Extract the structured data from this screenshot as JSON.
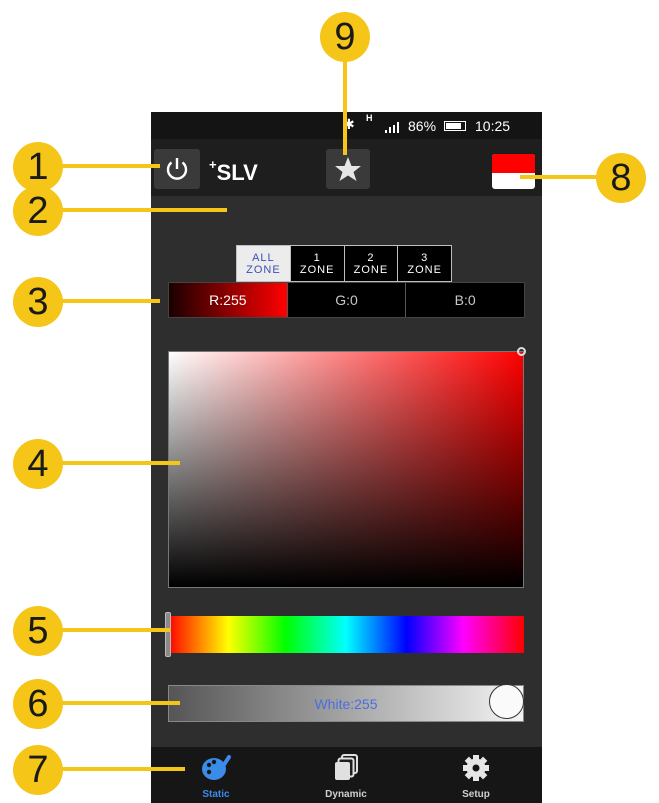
{
  "status_bar": {
    "bluetooth_icon": "bluetooth-icon",
    "network": "H",
    "battery_pct": "86%",
    "battery_level": 0.86,
    "time": "10:25"
  },
  "header": {
    "power_icon": "power-icon",
    "logo_plus": "+",
    "logo_text": "SLV",
    "favorite_icon": "star-icon",
    "current_color": "#ff0000"
  },
  "zones": [
    {
      "top": "ALL",
      "bottom": "ZONE",
      "active": true
    },
    {
      "top": "1",
      "bottom": "ZONE",
      "active": false
    },
    {
      "top": "2",
      "bottom": "ZONE",
      "active": false
    },
    {
      "top": "3",
      "bottom": "ZONE",
      "active": false
    }
  ],
  "rgb": {
    "r": "R:255",
    "g": "G:0",
    "b": "B:0"
  },
  "hue_slider_value": 0,
  "white": {
    "label": "White:255",
    "level": 1.0
  },
  "tabs": [
    {
      "label": "Static",
      "icon": "palette-icon",
      "active": true
    },
    {
      "label": "Dynamic",
      "icon": "layers-icon",
      "active": false
    },
    {
      "label": "Setup",
      "icon": "gear-icon",
      "active": false
    }
  ],
  "callouts": [
    "1",
    "2",
    "3",
    "4",
    "5",
    "6",
    "7",
    "8",
    "9"
  ],
  "colors": {
    "accent": "#3b8ce8",
    "callout": "#f5c518",
    "selected_color": "#ff0000"
  }
}
